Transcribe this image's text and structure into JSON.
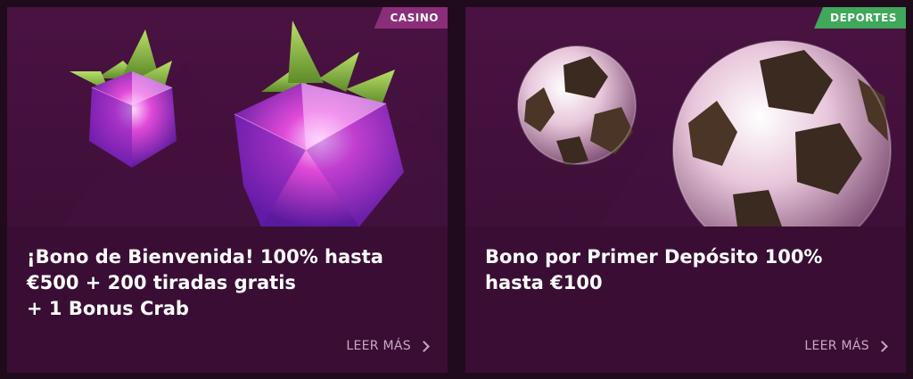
{
  "cards": [
    {
      "badge": "CASINO",
      "title_lines": [
        "¡Bono de Bienvenida! 100% hasta",
        "€500 + 200 tiradas gratis",
        "+ 1 Bonus Crab"
      ],
      "cta": "LEER MÁS",
      "art": "raspberry-gems-icon"
    },
    {
      "badge": "DEPORTES",
      "title_lines": [
        "Bono por Primer Depósito 100%",
        "hasta €100"
      ],
      "cta": "LEER MÁS",
      "art": "soccer-balls-icon"
    }
  ],
  "colors": {
    "background": "#1f0b1c",
    "card": "#3a0e34",
    "casino_badge": "#8a2e7a",
    "sports_badge": "#3fa85a",
    "cta_text": "#c9a9c3"
  }
}
